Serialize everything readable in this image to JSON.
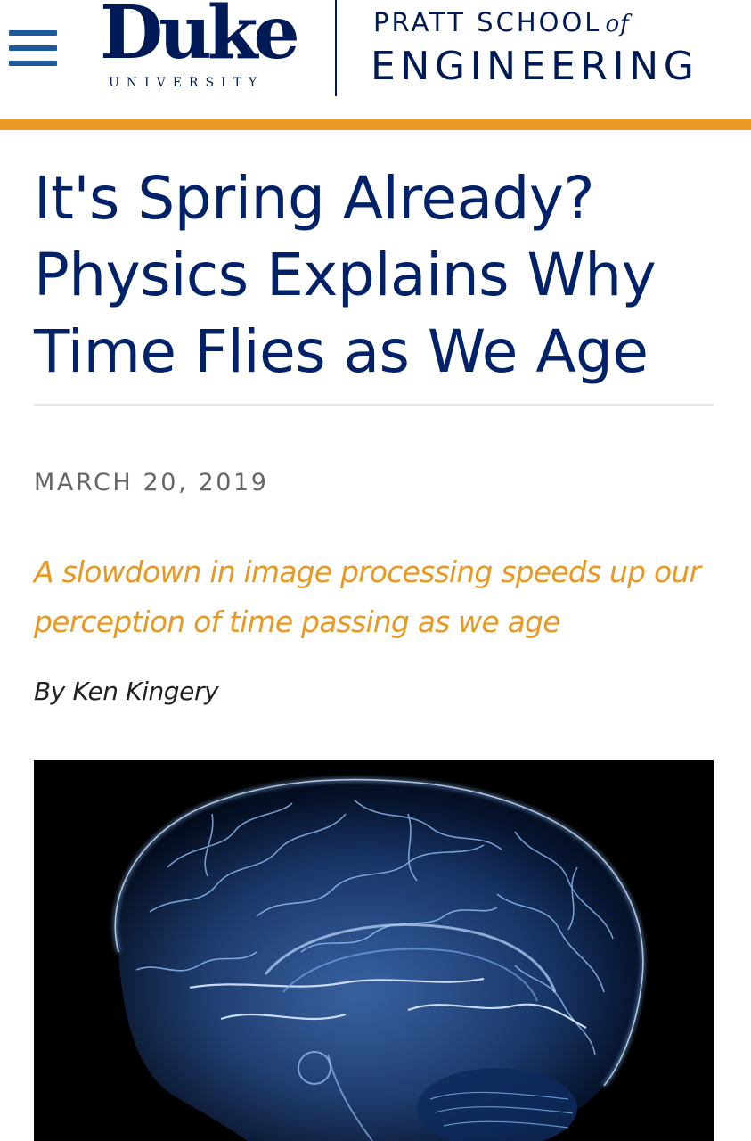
{
  "header": {
    "menu_icon": "hamburger-menu-icon",
    "logo_word": "Duke",
    "logo_sub": "UNIVERSITY",
    "school_top": "PRATT SCHOOL",
    "school_of": "of",
    "school_bottom": "ENGINEERING"
  },
  "colors": {
    "navy": "#001a57",
    "royal": "#012169",
    "menu_blue": "#1d5a9c",
    "accent_orange": "#e89923",
    "date_gray": "#666666",
    "byline_dark": "#222222"
  },
  "article": {
    "title": "It's Spring Already? Physics Explains Why Time Flies as We Age",
    "date": "MARCH 20, 2019",
    "subtitle": "A slowdown in image processing speeds up our perception of time passing as we age",
    "byline": "By Ken Kingery",
    "hero_image": "glowing-blue-brain-image"
  }
}
